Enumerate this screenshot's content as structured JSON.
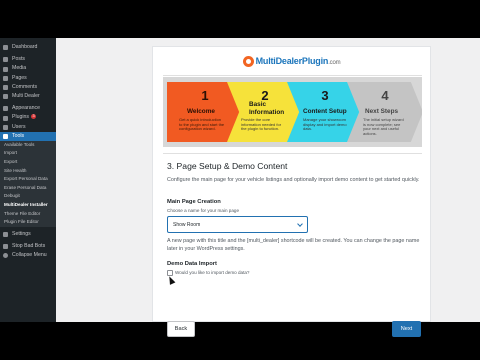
{
  "sidebar": {
    "items": [
      {
        "label": "Dashboard",
        "icon": "dashboard-icon"
      },
      {
        "label": "Posts",
        "icon": "pin-icon"
      },
      {
        "label": "Media",
        "icon": "media-icon"
      },
      {
        "label": "Pages",
        "icon": "page-icon"
      },
      {
        "label": "Comments",
        "icon": "comment-icon"
      },
      {
        "label": "Multi Dealer",
        "icon": "multidealer-icon"
      },
      {
        "label": "Appearance",
        "icon": "brush-icon"
      },
      {
        "label": "Plugins",
        "icon": "plugin-icon",
        "badge": "3"
      },
      {
        "label": "Users",
        "icon": "user-icon"
      },
      {
        "label": "Tools",
        "icon": "wrench-icon"
      }
    ],
    "tools_submenu": [
      "Available Tools",
      "Import",
      "Export",
      "Site Health",
      "Export Personal Data",
      "Erase Personal Data",
      "Debugit",
      "MultiDealer Installer",
      "Theme File Editor",
      "Plugin File Editor"
    ],
    "bottom_items": [
      {
        "label": "Settings",
        "icon": "settings-icon"
      },
      {
        "label": "Stop Bad Bots",
        "icon": "shield-icon"
      },
      {
        "label": "Collapse Menu",
        "icon": "collapse-icon"
      }
    ]
  },
  "logo": {
    "name": "MultiDealerPlugin",
    "domain": ".com"
  },
  "steps": [
    {
      "num": "1",
      "title": "Welcome",
      "desc": "Get a quick introduction to the plugin and start the configuration wizard."
    },
    {
      "num": "2",
      "title": "Basic Information",
      "desc": "Provide the core information needed for the plugin to function."
    },
    {
      "num": "3",
      "title": "Content Setup",
      "desc": "Manage your showroom display and import demo data."
    },
    {
      "num": "4",
      "title": "Next Steps",
      "desc": "The initial setup wizard is now complete; see your next and useful actions."
    }
  ],
  "section": {
    "heading": "3. Page Setup & Demo Content",
    "intro": "Configure the main page for your vehicle listings and optionally import demo content to get started quickly.",
    "main_page_label": "Main Page Creation",
    "main_page_sublabel": "Choose a name for your main page",
    "main_page_value": "Show Room",
    "help_text": "A new page with this title and the [multi_dealer] shortcode will be created. You can change the page name later in your WordPress settings.",
    "demo_label": "Demo Data Import",
    "demo_checkbox_label": "Would you like to import demo data?"
  },
  "buttons": {
    "back": "Back",
    "next": "Next"
  },
  "colors": {
    "accent": "#2271b1",
    "step1": "#f15a22",
    "step2": "#f6e23a",
    "step3": "#36d3e8",
    "step4": "#c4c4c4",
    "sidebar": "#1d2327"
  }
}
